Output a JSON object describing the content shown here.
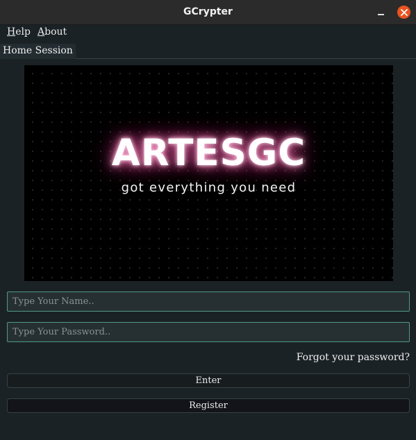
{
  "window": {
    "title": "GCrypter"
  },
  "menu": {
    "help": {
      "mnemonic": "H",
      "rest": "elp"
    },
    "about": {
      "mnemonic": "A",
      "rest": "bout"
    }
  },
  "tabs": [
    {
      "label": "Home Session"
    }
  ],
  "banner": {
    "brand": "ARTESGC",
    "tagline": "got everything you need"
  },
  "form": {
    "name_placeholder": "Type Your Name..",
    "password_placeholder": "Type Your Password..",
    "forgot_label": "Forgot your password?",
    "enter_label": "Enter",
    "register_label": "Register"
  },
  "colors": {
    "close_button": "#e95420",
    "field_border": "#4f9a85",
    "background": "#1b2225"
  }
}
